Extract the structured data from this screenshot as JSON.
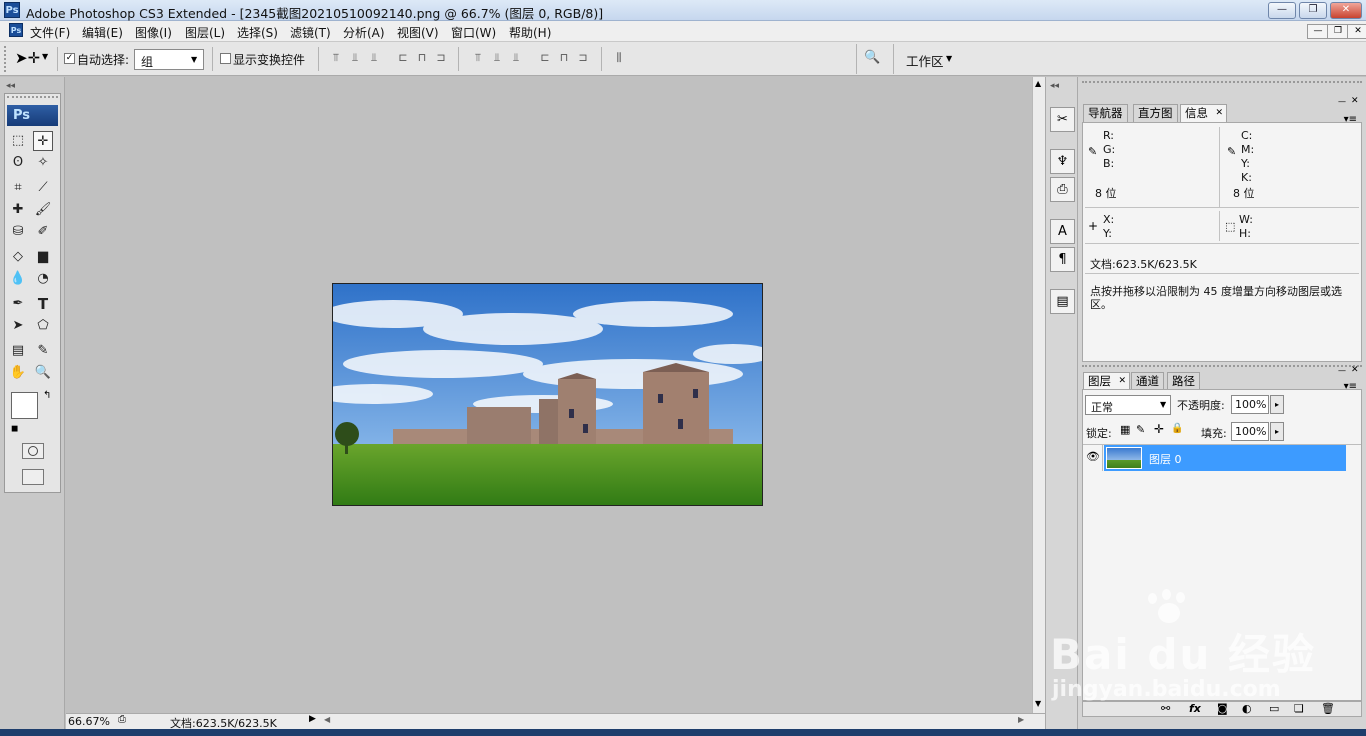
{
  "window": {
    "title": "Adobe Photoshop CS3 Extended - [2345截图20210510092140.png @ 66.7% (图层 0, RGB/8)]",
    "app_icon": "Ps"
  },
  "menus": [
    "文件(F)",
    "编辑(E)",
    "图像(I)",
    "图层(L)",
    "选择(S)",
    "滤镜(T)",
    "分析(A)",
    "视图(V)",
    "窗口(W)",
    "帮助(H)"
  ],
  "options": {
    "auto_select_label": "自动选择:",
    "auto_select_value": "组",
    "show_transform_label": "显示变换控件",
    "workspace_label": "工作区"
  },
  "tools": [
    "marquee-icon",
    "move-icon",
    "lasso-icon",
    "magic-wand-icon",
    "crop-icon",
    "slice-icon",
    "healing-icon",
    "brush-icon",
    "stamp-icon",
    "history-brush-icon",
    "eraser-icon",
    "gradient-icon",
    "blur-icon",
    "dodge-icon",
    "pen-icon",
    "text-icon",
    "path-select-icon",
    "shape-icon",
    "notes-icon",
    "eyedropper-icon",
    "hand-icon",
    "zoom-icon"
  ],
  "toolbox_logo": "Ps",
  "text_tool_glyph": "T",
  "colors": {
    "foreground": "#ffffff",
    "background": "#e8c80c",
    "selection": "#3d9bff"
  },
  "status": {
    "zoom": "66.67%",
    "doc": "文档:623.5K/623.5K"
  },
  "info_panel": {
    "tabs": [
      "导航器",
      "直方图",
      "信息"
    ],
    "left_channels": [
      "R:",
      "G:",
      "B:"
    ],
    "right_channels": [
      "C:",
      "M:",
      "Y:",
      "K:"
    ],
    "bits_left": "8 位",
    "bits_right": "8 位",
    "xy": [
      "X:",
      "Y:"
    ],
    "wh": [
      "W:",
      "H:"
    ],
    "doc": "文档:623.5K/623.5K",
    "hint": "点按并拖移以沿限制为 45 度增量方向移动图层或选区。"
  },
  "layers_panel": {
    "tabs": [
      "图层",
      "通道",
      "路径"
    ],
    "blend_mode": "正常",
    "opacity_label": "不透明度:",
    "opacity": "100%",
    "lock_label": "锁定:",
    "fill_label": "填充:",
    "fill": "100%",
    "layers": [
      {
        "name": "图层 0",
        "selected": true
      }
    ]
  },
  "dock_glyphs": [
    "✂",
    "♆",
    "⎙",
    "A",
    "¶",
    "▤"
  ],
  "watermark": {
    "brand": "Bai du 经验",
    "url": "jingyan.baidu.com"
  }
}
